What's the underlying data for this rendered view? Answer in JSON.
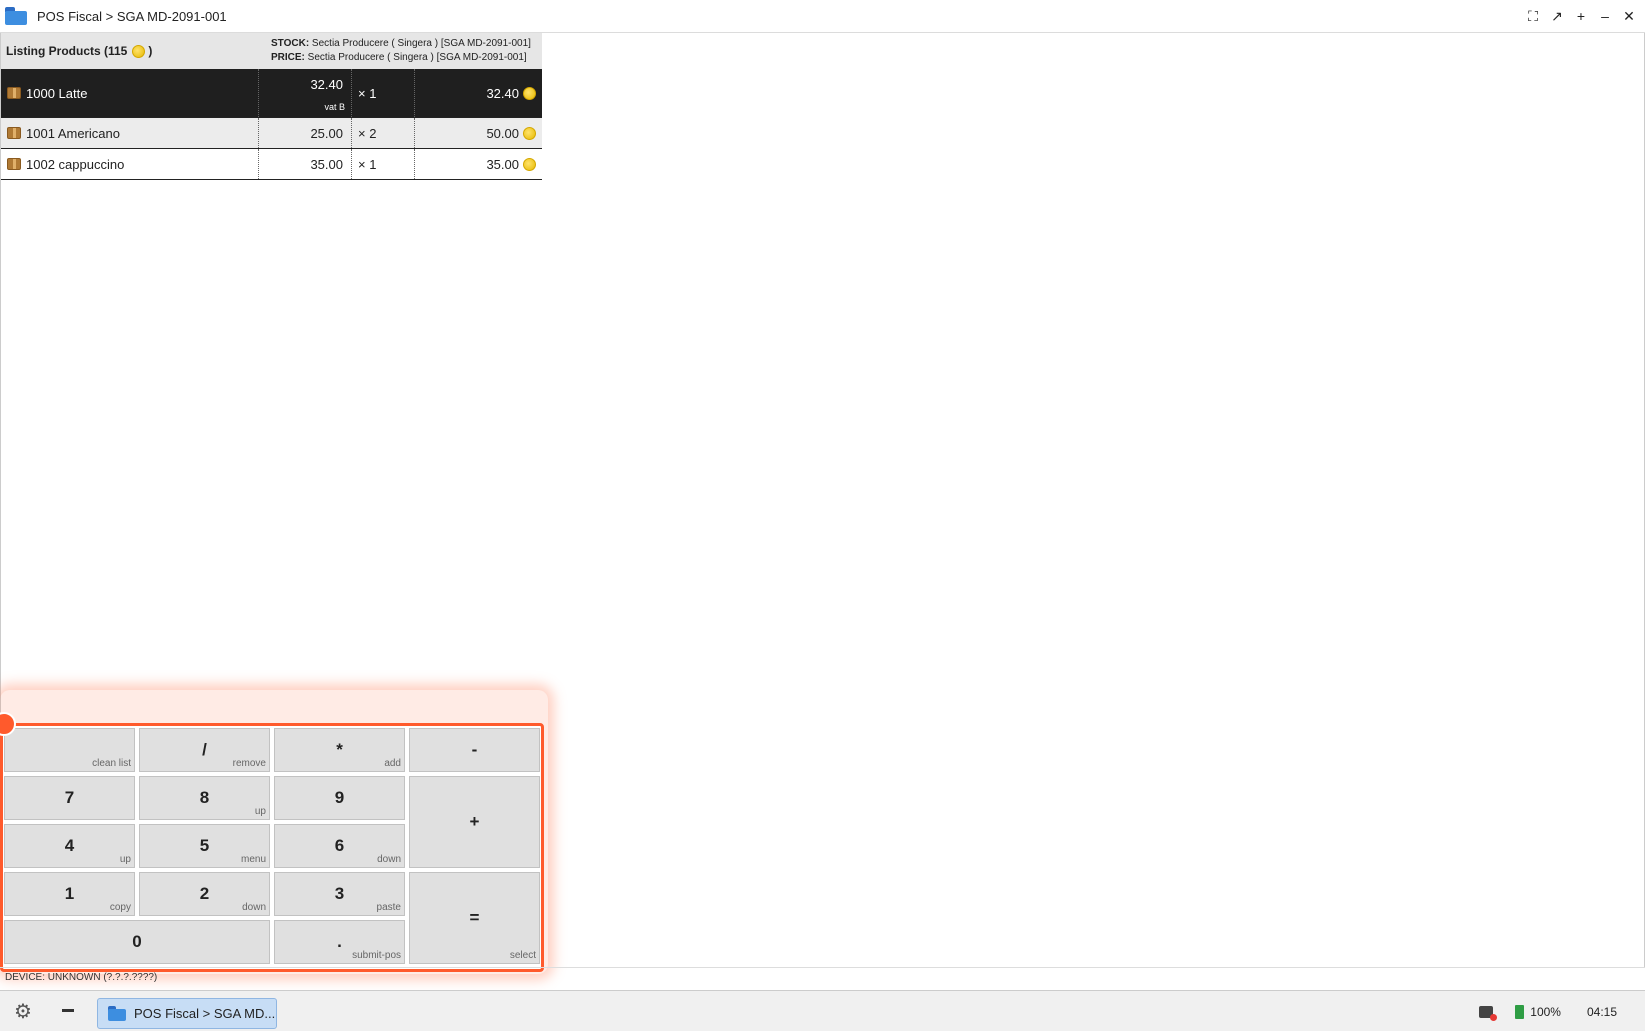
{
  "window": {
    "title": "POS Fiscal > SGA MD-2091-001",
    "controls": [
      "fullscreen-icon",
      "popout-icon",
      "add-icon",
      "minimize-icon",
      "close-icon"
    ],
    "control_glyphs": [
      "⛶",
      "↗",
      "+",
      "–",
      "✕"
    ]
  },
  "listing": {
    "title": "Listing Products (115",
    "title_close": ")",
    "stock_label": "STOCK:",
    "stock_value": " Sectia Producere ( Singera ) [SGA MD-2091-001]",
    "price_label": "PRICE:",
    "price_value": " Sectia Producere ( Singera ) [SGA MD-2091-001]",
    "rows": [
      {
        "name": "1000 Latte",
        "price": "32.40",
        "vat": "vat B",
        "qty": "× 1",
        "total": "32.40",
        "selected": true
      },
      {
        "name": "1001 Americano",
        "price": "25.00",
        "vat": "",
        "qty": "× 2",
        "total": "50.00",
        "selected": false
      },
      {
        "name": "1002 cappuccino",
        "price": "35.00",
        "vat": "",
        "qty": "× 1",
        "total": "35.00",
        "selected": false
      }
    ]
  },
  "keypad": {
    "keys": [
      {
        "id": "clean",
        "main": "",
        "sub": "clean list"
      },
      {
        "id": "divide",
        "main": "/",
        "sub": "remove"
      },
      {
        "id": "multiply",
        "main": "*",
        "sub": "add"
      },
      {
        "id": "minus",
        "main": "-",
        "sub": ""
      },
      {
        "id": "seven",
        "main": "7",
        "sub": ""
      },
      {
        "id": "eight",
        "main": "8",
        "sub": "up"
      },
      {
        "id": "nine",
        "main": "9",
        "sub": ""
      },
      {
        "id": "plus",
        "main": "+",
        "sub": ""
      },
      {
        "id": "four",
        "main": "4",
        "sub": "up"
      },
      {
        "id": "five",
        "main": "5",
        "sub": "menu"
      },
      {
        "id": "six",
        "main": "6",
        "sub": "down"
      },
      {
        "id": "one",
        "main": "1",
        "sub": "copy"
      },
      {
        "id": "two",
        "main": "2",
        "sub": "down"
      },
      {
        "id": "three",
        "main": "3",
        "sub": "paste"
      },
      {
        "id": "equals",
        "main": "=",
        "sub": "select"
      },
      {
        "id": "zero",
        "main": "0",
        "sub": ""
      },
      {
        "id": "dot",
        "main": ".",
        "sub": "submit-pos"
      }
    ]
  },
  "status": {
    "device": "DEVICE: UNKNOWN (?.?.?.????)"
  },
  "taskbar": {
    "task_label": "POS Fiscal > SGA MD...",
    "battery": "100%",
    "clock": "04:15"
  },
  "colors": {
    "selected_row": "#1f1f1f",
    "keypad_highlight": "#ff5a2c",
    "coin": "#f2c400",
    "task_active": "#c7ddf5"
  }
}
